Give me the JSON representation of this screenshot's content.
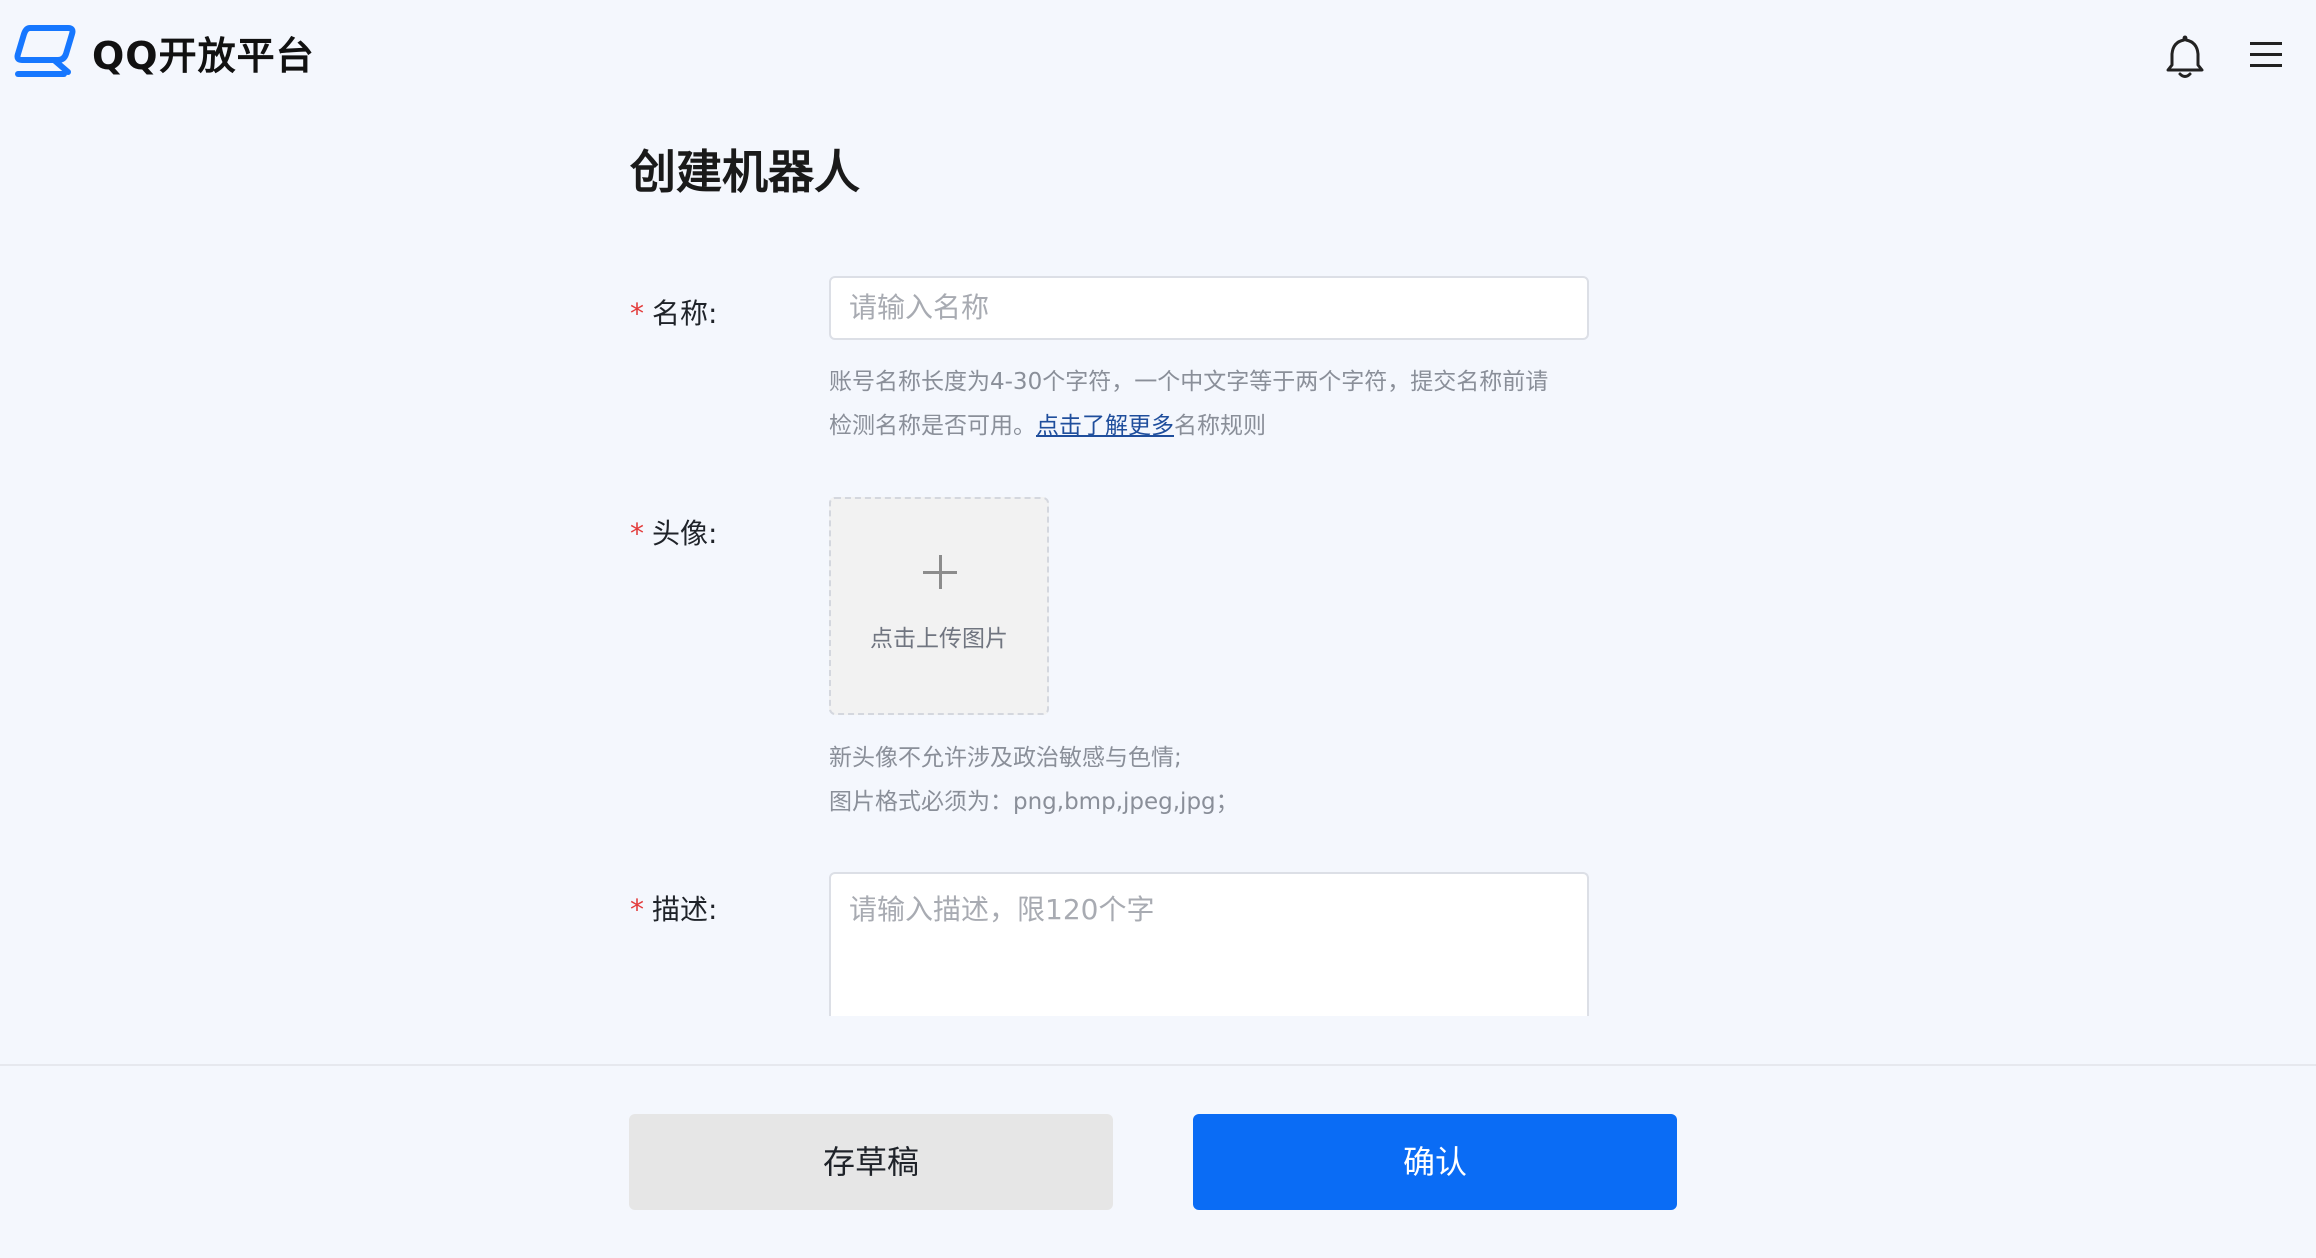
{
  "header": {
    "brand": "QQ开放平台",
    "icons": {
      "logo": "qq-open-platform-logo",
      "notification": "bell-icon",
      "menu": "hamburger-menu-icon"
    }
  },
  "page": {
    "title": "创建机器人"
  },
  "form": {
    "name": {
      "label": "名称:",
      "required_mark": "*",
      "placeholder": "请输入名称",
      "hint_line1": "账号名称长度为4-30个字符，一个中文字等于两个字符，提交名称前请",
      "hint_line2_prefix": "检测名称是否可用。",
      "hint_link": "点击了解更多",
      "hint_line2_suffix": "名称规则"
    },
    "avatar": {
      "label": "头像:",
      "required_mark": "*",
      "upload_text": "点击上传图片",
      "hint_line1": "新头像不允许涉及政治敏感与色情;",
      "hint_line2": "图片格式必须为：png,bmp,jpeg,jpg；"
    },
    "description": {
      "label": "描述:",
      "required_mark": "*",
      "placeholder": "请输入描述，限120个字"
    }
  },
  "footer": {
    "save_draft": "存草稿",
    "confirm": "确认"
  },
  "colors": {
    "background": "#f4f7fd",
    "primary": "#0a6cf5",
    "required": "#e33b3b",
    "link": "#1f4e9c"
  }
}
